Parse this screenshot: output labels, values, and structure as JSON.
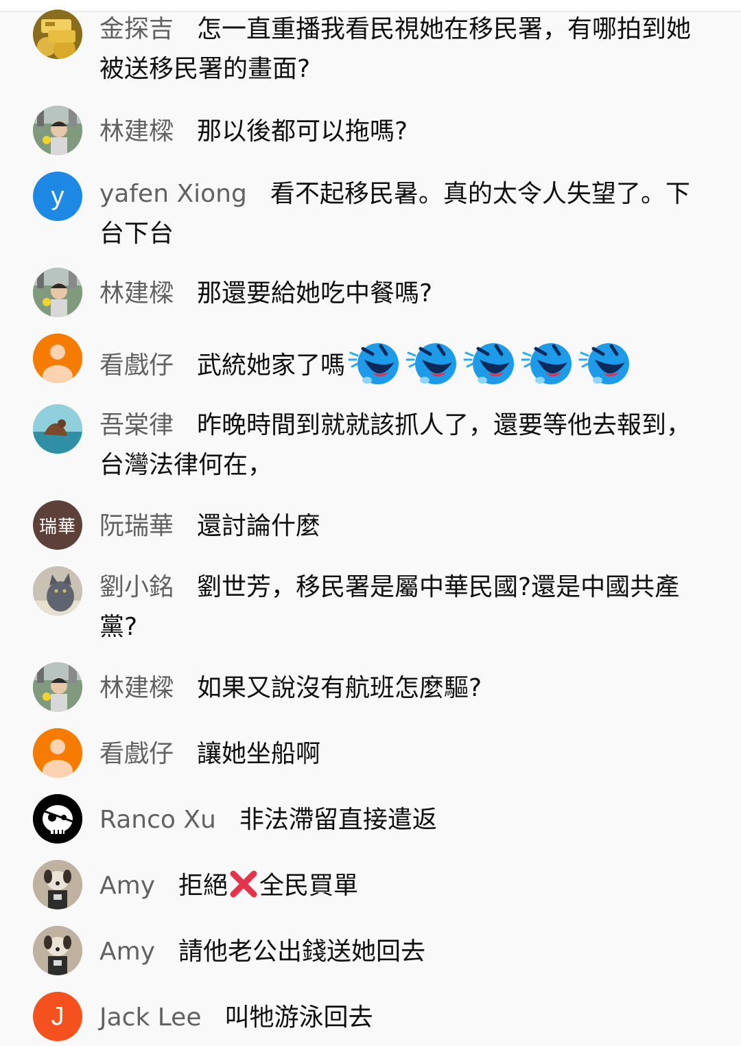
{
  "comments": [
    {
      "author": "金探吉",
      "text": "怎一直重播我看民視她在移民署，有哪拍到她被送移民署的畫面?",
      "avatar": "gold-bars-photo"
    },
    {
      "author": "林建樑",
      "text": "那以後都可以拖嗎?",
      "avatar": "child-photo"
    },
    {
      "author": "yafen Xiong",
      "text": "看不起移民暑。真的太令人失望了。下台下台",
      "avatar": "letter",
      "avatar_letter": "y",
      "avatar_color": "#1e88e5"
    },
    {
      "author": "林建樑",
      "text": "那還要給她吃中餐嗎?",
      "avatar": "child-photo"
    },
    {
      "author": "看戲仔",
      "text": "武統她家了嗎",
      "avatar": "default-person",
      "avatar_color": "#f57c00",
      "emoji": "laughing-face-emoji",
      "emoji_count": 5
    },
    {
      "author": "吾棠律",
      "text": "昨晚時間到就就該抓人了，還要等他去報到，台灣法律何在，",
      "avatar": "sea-lion-photo"
    },
    {
      "author": "阮瑞華",
      "text": "還討論什麼",
      "avatar": "text",
      "avatar_text": "瑞華",
      "avatar_color": "#5d4037"
    },
    {
      "author": "劉小銘",
      "text": "劉世芳，移民署是屬中華民國?還是中國共產黨?",
      "avatar": "cat-photo"
    },
    {
      "author": "林建樑",
      "text": "如果又說沒有航班怎麼驅?",
      "avatar": "child-photo"
    },
    {
      "author": "看戲仔",
      "text": "讓她坐船啊",
      "avatar": "default-person",
      "avatar_color": "#f57c00"
    },
    {
      "author": "Ranco Xu",
      "text": "非法滯留直接遣返",
      "avatar": "pirate-skull"
    },
    {
      "author": "Amy",
      "text_before": "拒絕",
      "x_emoji": "cross-mark-emoji",
      "text_after": "全民買單",
      "avatar": "plush-toy-photo"
    },
    {
      "author": "Amy",
      "text": "請他老公出錢送她回去",
      "avatar": "plush-toy-photo"
    },
    {
      "author": "Jack Lee",
      "text": "叫牠游泳回去",
      "avatar": "letter",
      "avatar_letter": "J",
      "avatar_color": "#f4511e"
    }
  ]
}
